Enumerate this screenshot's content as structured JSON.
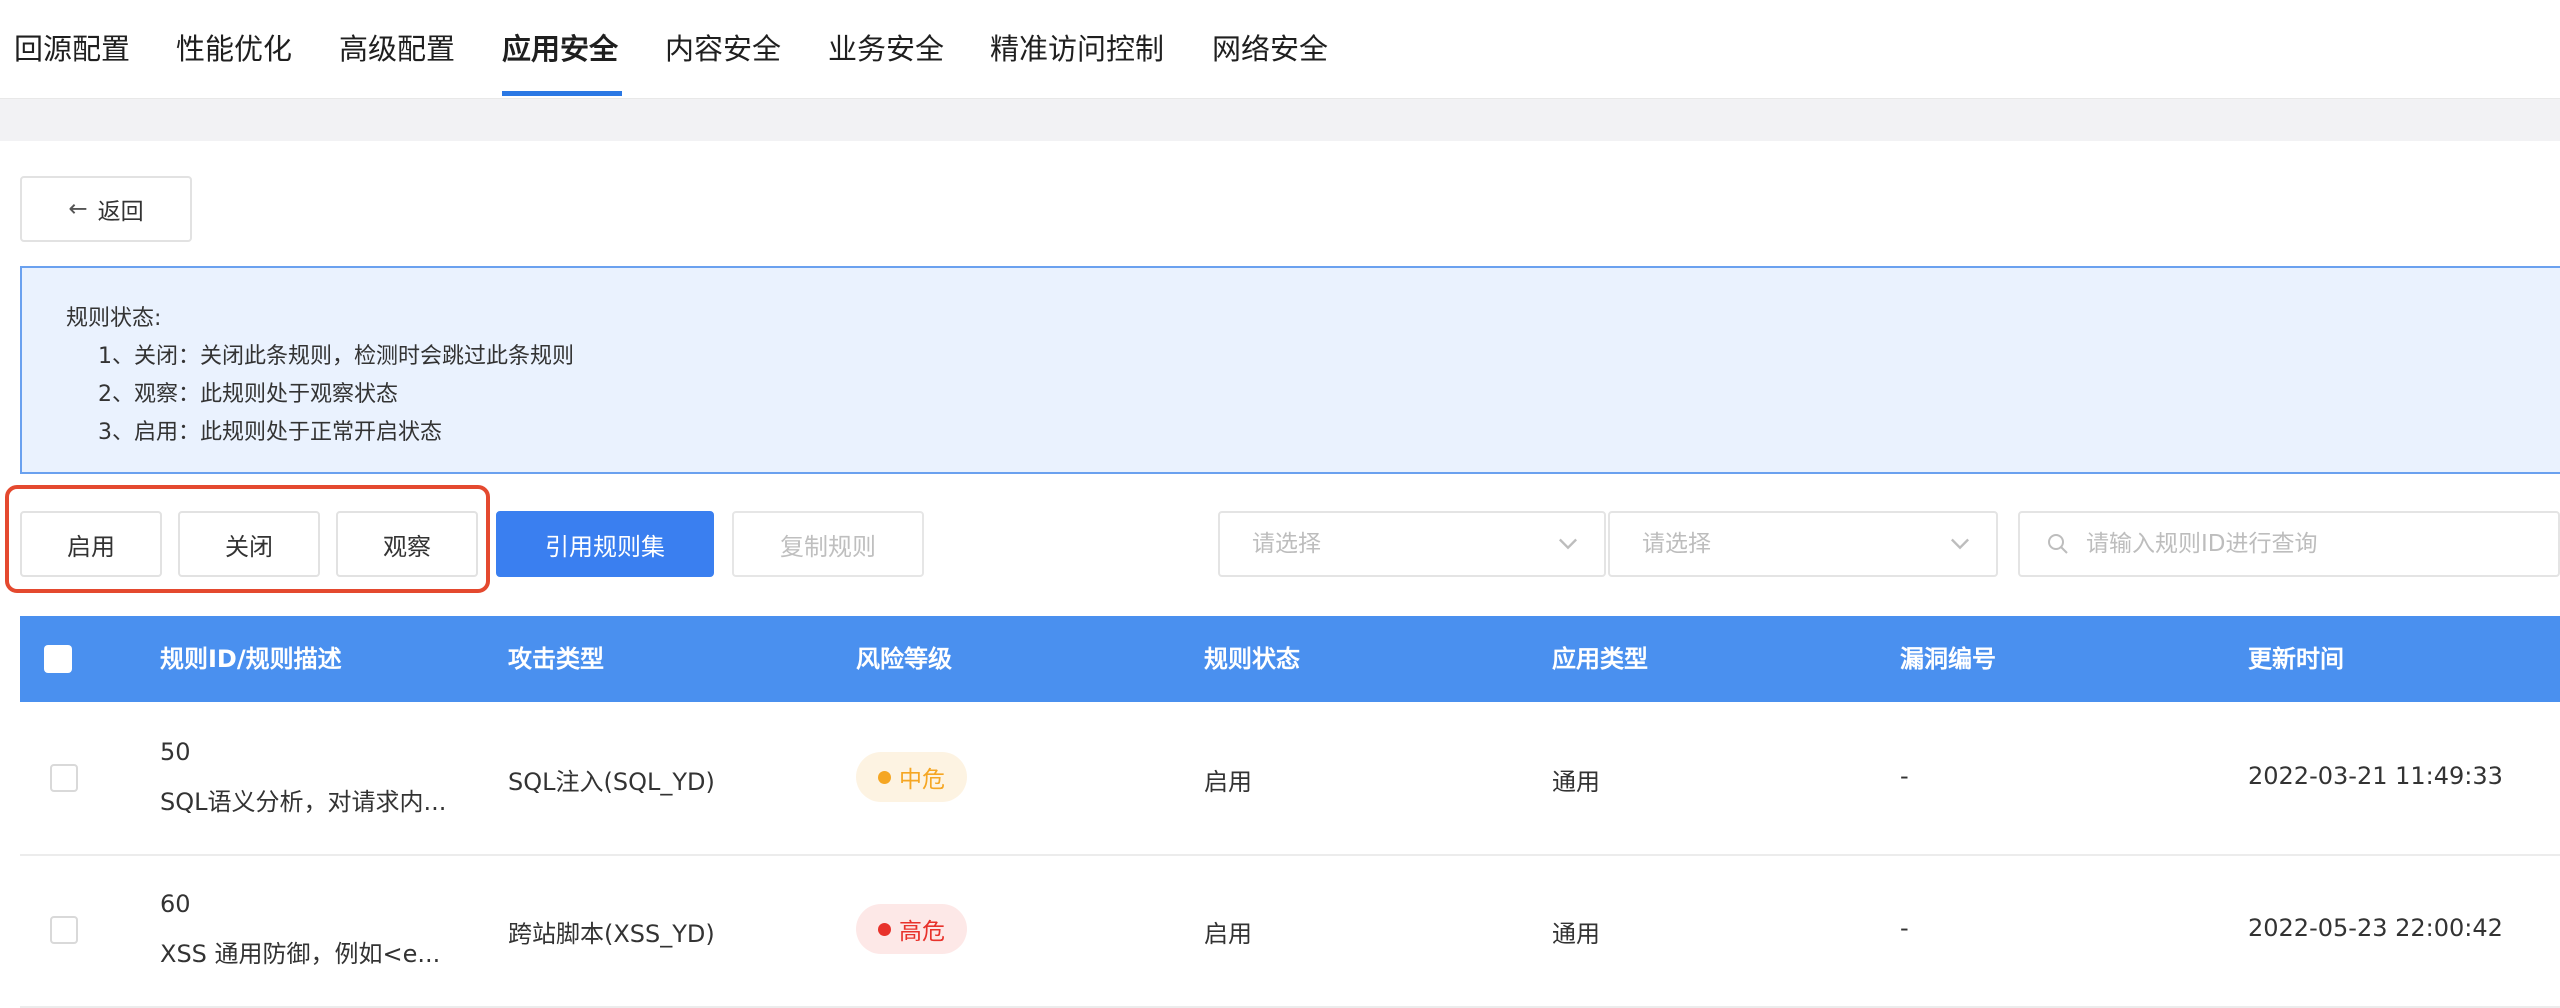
{
  "nav": {
    "tabs": [
      "回源配置",
      "性能优化",
      "高级配置",
      "应用安全",
      "内容安全",
      "业务安全",
      "精准访问控制",
      "网络安全"
    ],
    "active": "应用安全"
  },
  "back_label": "返回",
  "info": {
    "title": "规则状态:",
    "lines": [
      "1、关闭：关闭此条规则，检测时会跳过此条规则",
      "2、观察：此规则处于观察状态",
      "3、启用：此规则处于正常开启状态"
    ]
  },
  "actions": {
    "enable": "启用",
    "close": "关闭",
    "observe": "观察",
    "apply_ruleset": "引用规则集",
    "copy_rule": "复制规则"
  },
  "filters": {
    "select1_placeholder": "请选择",
    "select2_placeholder": "请选择",
    "search_placeholder": "请输入规则ID进行查询"
  },
  "table": {
    "headers": [
      "规则ID/规则描述",
      "攻击类型",
      "风险等级",
      "规则状态",
      "应用类型",
      "漏洞编号",
      "更新时间"
    ],
    "rows": [
      {
        "id": "50",
        "desc": "SQL语义分析，对请求内...",
        "attack_type": "SQL注入(SQL_YD)",
        "risk": "中危",
        "risk_color": "#f5a623",
        "risk_bg": "#fdf3e2",
        "status": "启用",
        "app_type": "通用",
        "vuln_id": "-",
        "updated": "2022-03-21 11:49:33"
      },
      {
        "id": "60",
        "desc": "XSS 通用防御，例如<e...",
        "attack_type": "跨站脚本(XSS_YD)",
        "risk": "高危",
        "risk_color": "#e8322b",
        "risk_bg": "#fde8e7",
        "status": "启用",
        "app_type": "通用",
        "vuln_id": "-",
        "updated": "2022-05-23 22:00:42"
      }
    ]
  },
  "colors": {
    "accent": "#3a7ff0",
    "header": "#4a90ef",
    "highlight_box": "#e4492f"
  }
}
